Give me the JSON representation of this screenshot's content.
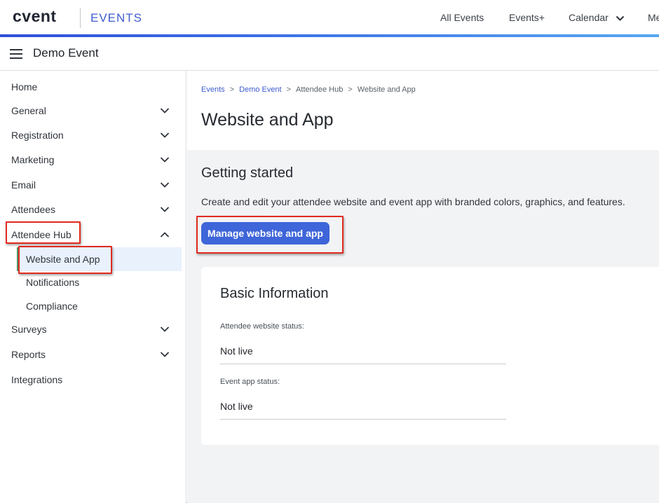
{
  "topbar": {
    "logo": "cvent",
    "product": "EVENTS",
    "nav": {
      "all_events": "All Events",
      "events_plus": "Events+",
      "calendar": "Calendar",
      "me_truncated": "Me"
    }
  },
  "event_header": {
    "menu_icon": "hamburger-icon",
    "title": "Demo Event"
  },
  "sidebar": {
    "items": [
      {
        "label": "Home",
        "expandable": false
      },
      {
        "label": "General",
        "expandable": true
      },
      {
        "label": "Registration",
        "expandable": true
      },
      {
        "label": "Marketing",
        "expandable": true
      },
      {
        "label": "Email",
        "expandable": true
      },
      {
        "label": "Attendees",
        "expandable": true
      },
      {
        "label": "Attendee Hub",
        "expandable": true,
        "expanded": true
      },
      {
        "label": "Website and App",
        "sub": true,
        "active": true
      },
      {
        "label": "Notifications",
        "sub": true
      },
      {
        "label": "Compliance",
        "sub": true
      },
      {
        "label": "Surveys",
        "expandable": true
      },
      {
        "label": "Reports",
        "expandable": true
      },
      {
        "label": "Integrations",
        "expandable": false
      }
    ]
  },
  "breadcrumb": {
    "events": "Events",
    "demo_event": "Demo Event",
    "attendee_hub": "Attendee Hub",
    "current": "Website and App",
    "separator": ">"
  },
  "main": {
    "title": "Website and App",
    "getting_started": {
      "title": "Getting started",
      "description": "Create and edit your attendee website and event app with branded colors, graphics, and features.",
      "button_label": "Manage website and app"
    },
    "basic_info": {
      "title": "Basic Information",
      "website_status_label": "Attendee website status:",
      "website_status_value": "Not live",
      "app_status_label": "Event app status:",
      "app_status_value": "Not live"
    }
  },
  "colors": {
    "accent": "#3e65d9",
    "link": "#3d5ccf",
    "highlight_box": "#e02b1f",
    "active_bar": "#4d9c6a",
    "active_bg": "#e9f1fd",
    "section_bg": "#f2f3f5"
  }
}
